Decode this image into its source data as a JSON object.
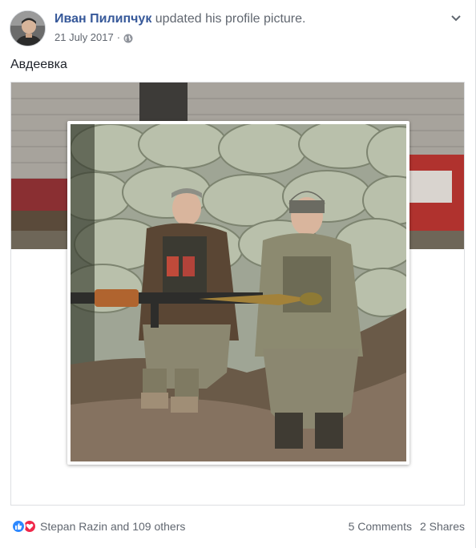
{
  "post": {
    "author": "Иван Пилипчук",
    "action": "updated his profile picture.",
    "date": "21 July 2017",
    "separator": "·",
    "privacy_icon": "globe-icon",
    "menu_icon": "chevron-down-icon",
    "caption": "Авдеевка"
  },
  "footer": {
    "reactions_text": "Stepan Razin and 109 others",
    "reaction_icons": [
      "like-icon",
      "love-icon"
    ],
    "comments": "5 Comments",
    "shares": "2 Shares"
  },
  "colors": {
    "link": "#365899",
    "secondary_text": "#616770",
    "like_blue": "#2e89ff",
    "love_red": "#f0284a",
    "border": "#dddfe2"
  }
}
